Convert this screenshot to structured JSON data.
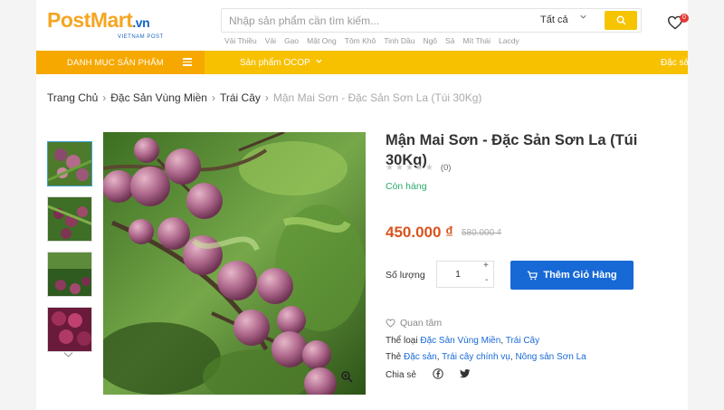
{
  "brand": {
    "logo_main": "PostMart",
    "logo_suffix": ".vn",
    "logo_sub": "VIETNAM POST"
  },
  "search": {
    "placeholder": "Nhập sản phẩm cần tìm kiếm...",
    "category": "Tất cả"
  },
  "cart": {
    "badge": "0"
  },
  "keywords": [
    "Vải Thiều",
    "Vải",
    "Gạo",
    "Mật Ong",
    "Tôm Khô",
    "Tinh Dầu",
    "Ngô",
    "Sả",
    "Mít Thái",
    "Lacdy"
  ],
  "nav": {
    "category_label": "DANH MỤC SẢN PHẨM",
    "ocop_label": "Sản phẩm OCOP",
    "right_label": "Đặc sả"
  },
  "breadcrumb": {
    "items": [
      "Trang Chủ",
      "Đặc Sản Vùng Miền",
      "Trái Cây"
    ],
    "current": "Mận Mai Sơn - Đặc Sản Sơn La (Túi 30Kg)",
    "separator": "›"
  },
  "product": {
    "title": "Mận Mai Sơn - Đặc Sản Sơn La (Túi 30Kg)",
    "rating_stars": 0,
    "rating_count": "(0)",
    "stock": "Còn hàng",
    "price": "450.000 ₫",
    "old_price": "580.000 ₫",
    "qty_label": "Số lượng",
    "qty_value": "1",
    "add_to_cart": "Thêm Giỏ Hàng",
    "wishlist": "Quan tâm",
    "category_label": "Thể loại",
    "categories": [
      "Đặc Sản Vùng Miền",
      "Trái Cây"
    ],
    "tag_label": "Thẻ",
    "tags": [
      "Đặc sản",
      "Trái cây chính vụ",
      "Nông sản Sơn La"
    ],
    "share_label": "Chia sẻ"
  },
  "colors": {
    "brand_orange": "#f5a623",
    "brand_blue": "#1565c0",
    "nav_yellow": "#f7c100",
    "category_orange": "#f6a800",
    "price_orange": "#d9531e",
    "button_blue": "#1769d6",
    "stock_green": "#2aa86c"
  }
}
